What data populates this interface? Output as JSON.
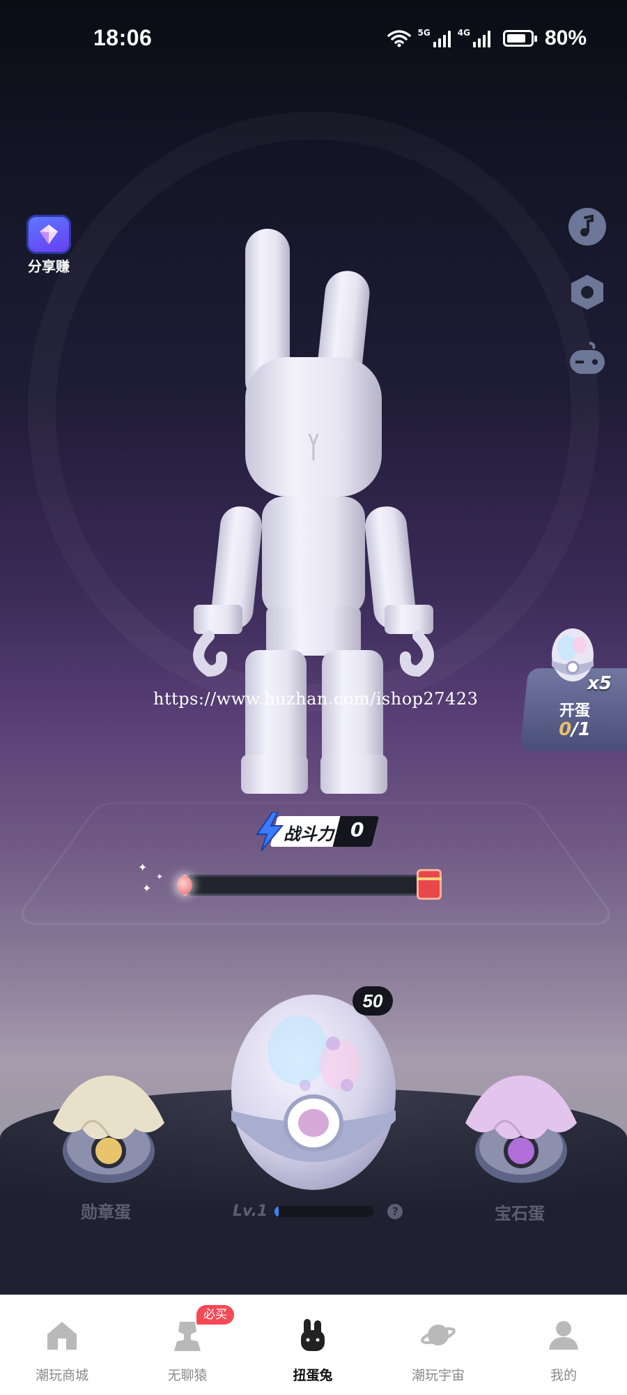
{
  "status_bar": {
    "time": "18:06",
    "network_5g": "5G",
    "network_4g": "4G",
    "battery_percent_text": "80%",
    "battery_level": 0.8
  },
  "share": {
    "label": "分享赚",
    "icon": "gem-icon"
  },
  "side_buttons": [
    {
      "icon": "music-note-icon"
    },
    {
      "icon": "settings-hex-icon"
    },
    {
      "icon": "gamepad-icon"
    }
  ],
  "watermark": "https://www.huzhan.com/ishop27423",
  "open_egg": {
    "multiplier": "x5",
    "label": "开蛋",
    "count_current": "0",
    "count_total": "/1"
  },
  "power": {
    "label": "战斗力",
    "value": "0",
    "icon": "lightning-icon"
  },
  "progress": {
    "fraction": 0.02,
    "reward_icon": "red-envelope-icon"
  },
  "eggs": {
    "left": {
      "label": "勋章蛋"
    },
    "main": {
      "badge": "50",
      "level_text": "Lv.1",
      "level_fraction": 0.04,
      "help": "?"
    },
    "right": {
      "label": "宝石蛋"
    }
  },
  "colors": {
    "accent_red": "#f44a56",
    "level_blue": "#3b82f6",
    "gold": "#e7c06a"
  },
  "nav": {
    "items": [
      {
        "label": "潮玩商城",
        "icon": "home-icon"
      },
      {
        "label": "无聊猿",
        "icon": "ape-icon",
        "badge": "必买"
      },
      {
        "label": "扭蛋兔",
        "icon": "rabbit-icon",
        "active": true
      },
      {
        "label": "潮玩宇宙",
        "icon": "planet-icon"
      },
      {
        "label": "我的",
        "icon": "user-icon"
      }
    ]
  }
}
